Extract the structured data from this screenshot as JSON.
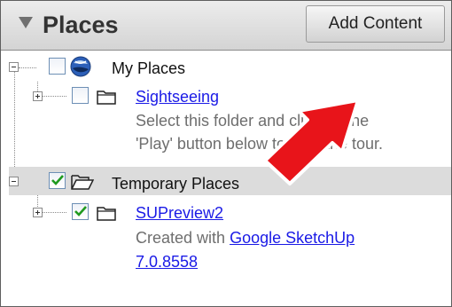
{
  "panel": {
    "title": "Places",
    "add_content_label": "Add Content"
  },
  "tree": {
    "my_places": {
      "label": "My Places",
      "checked": false,
      "icon": "earth-globe-icon",
      "children": {
        "sightseeing": {
          "label": "Sightseeing",
          "checked": false,
          "icon": "folder-icon",
          "description_line1": "Select this folder and click on the",
          "description_line2": "'Play' button below to start the tour."
        }
      }
    },
    "temporary_places": {
      "label": "Temporary Places",
      "checked": true,
      "icon": "open-folder-icon",
      "selected": true,
      "children": {
        "supreview2": {
          "label": "SUPreview2",
          "checked": true,
          "icon": "folder-icon",
          "description_prefix": "Created with ",
          "description_link_line1": "Google SketchUp ",
          "description_link_line2": "7.0.8558"
        }
      }
    }
  },
  "annotation": {
    "arrow_color": "#e8141a",
    "arrow_icon": "red-arrow-annotation"
  },
  "colors": {
    "link": "#1a1ae6",
    "description": "#6e6e6e",
    "checkmark": "#1f9a1f",
    "selection": "#dcdcdc"
  }
}
